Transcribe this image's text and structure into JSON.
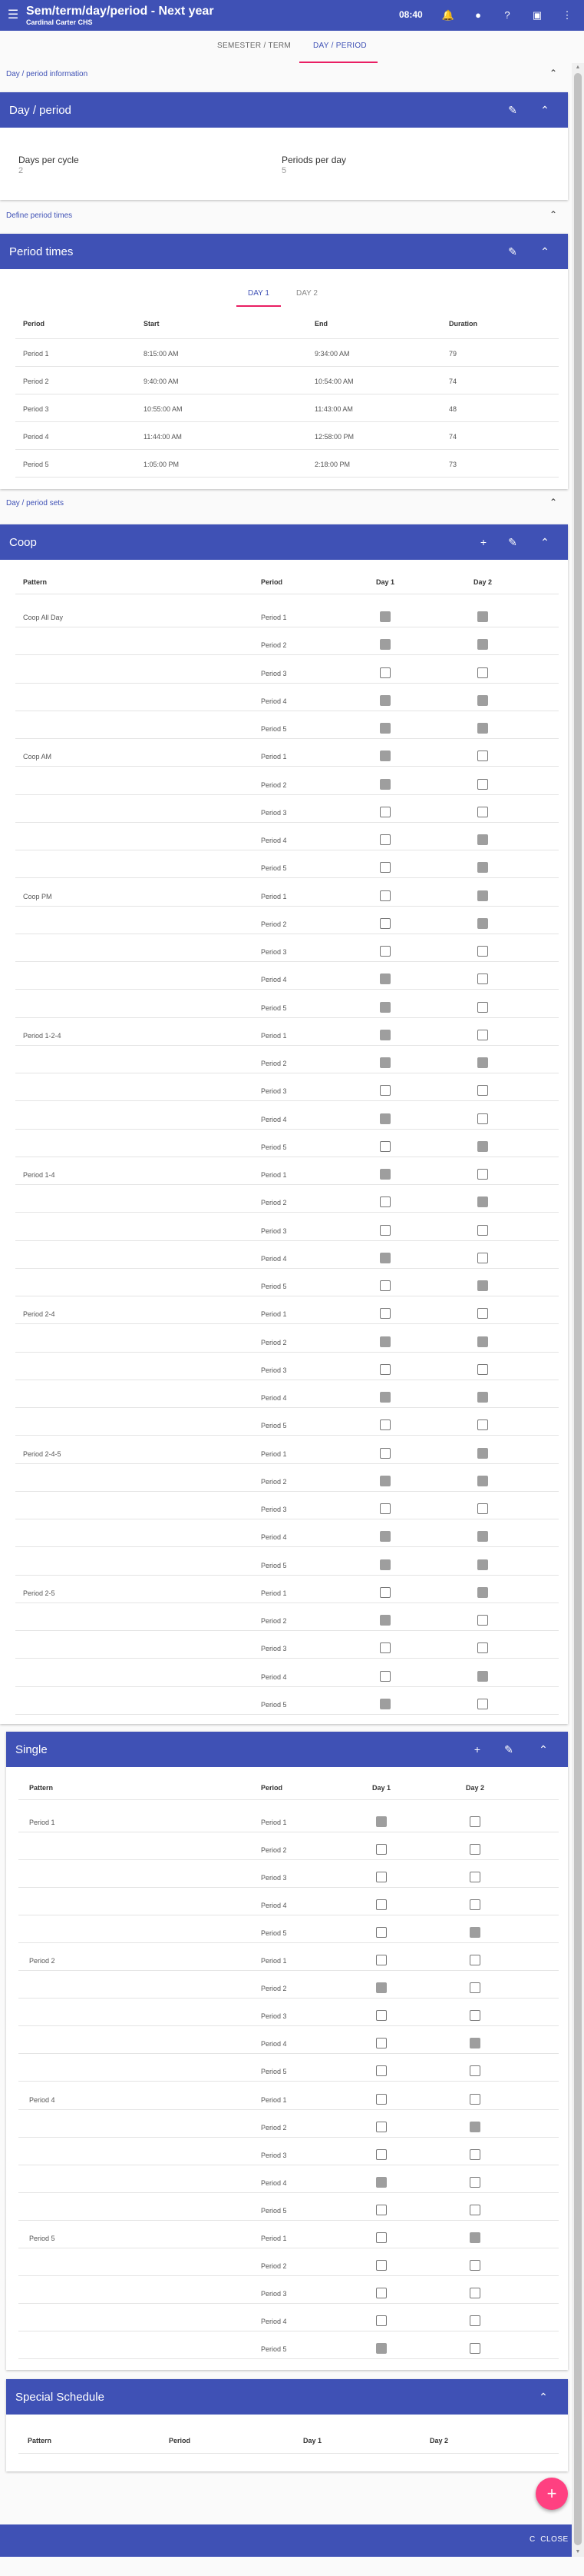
{
  "topbar": {
    "menu_icon": "menu-icon",
    "title": "Sem/term/day/period - Next year",
    "subtitle": "Cardinal Carter CHS",
    "time": "08:40",
    "icons": [
      "bell-icon",
      "person-icon",
      "help-icon",
      "screen-icon",
      "more-vert-icon"
    ]
  },
  "subnav": {
    "tabs": [
      "SEMESTER / TERM",
      "DAY / PERIOD"
    ],
    "active": 1
  },
  "day_period_information": {
    "section_title": "Day / period information",
    "card_title": "Day / period",
    "days_per_cycle_label": "Days per cycle",
    "days_per_cycle_value": "2",
    "periods_per_day_label": "Periods per day",
    "periods_per_day_value": "5"
  },
  "period_times": {
    "section_title": "Define period times",
    "card_title": "Period times",
    "tabs": [
      "DAY 1",
      "DAY 2"
    ],
    "active_tab": 0,
    "headers": [
      "Period",
      "Start",
      "End",
      "Duration"
    ],
    "rows": [
      [
        "Period 1",
        "8:15:00 AM",
        "9:34:00 AM",
        "79"
      ],
      [
        "Period 2",
        "9:40:00 AM",
        "10:54:00 AM",
        "74"
      ],
      [
        "Period 3",
        "10:55:00 AM",
        "11:43:00 AM",
        "48"
      ],
      [
        "Period 4",
        "11:44:00 AM",
        "12:58:00 PM",
        "74"
      ],
      [
        "Period 5",
        "1:05:00 PM",
        "2:18:00 PM",
        "73"
      ]
    ]
  },
  "period_sets": {
    "section_title": "Day / period sets",
    "headers": [
      "Pattern",
      "Period",
      "Day 1",
      "Day 2"
    ],
    "coop": {
      "title": "Coop",
      "patterns": [
        {
          "name": "Coop All Day",
          "periods": [
            "Period 1",
            "Period 2",
            "Period 3",
            "Period 4",
            "Period 5"
          ],
          "day1": [
            true,
            true,
            false,
            true,
            true
          ],
          "day2": [
            true,
            true,
            false,
            true,
            true
          ]
        },
        {
          "name": "Coop AM",
          "periods": [
            "Period 1",
            "Period 2",
            "Period 3",
            "Period 4",
            "Period 5"
          ],
          "day1": [
            true,
            true,
            false,
            false,
            false
          ],
          "day2": [
            false,
            false,
            false,
            true,
            true
          ]
        },
        {
          "name": "Coop PM",
          "periods": [
            "Period 1",
            "Period 2",
            "Period 3",
            "Period 4",
            "Period 5"
          ],
          "day1": [
            false,
            false,
            false,
            true,
            true
          ],
          "day2": [
            true,
            true,
            false,
            false,
            false
          ]
        },
        {
          "name": "Period 1-2-4",
          "periods": [
            "Period 1",
            "Period 2",
            "Period 3",
            "Period 4",
            "Period 5"
          ],
          "day1": [
            true,
            true,
            false,
            true,
            false
          ],
          "day2": [
            false,
            true,
            false,
            false,
            true
          ]
        },
        {
          "name": "Period 1-4",
          "periods": [
            "Period 1",
            "Period 2",
            "Period 3",
            "Period 4",
            "Period 5"
          ],
          "day1": [
            true,
            false,
            false,
            true,
            false
          ],
          "day2": [
            false,
            true,
            false,
            false,
            true
          ]
        },
        {
          "name": "Period 2-4",
          "periods": [
            "Period 1",
            "Period 2",
            "Period 3",
            "Period 4",
            "Period 5"
          ],
          "day1": [
            false,
            true,
            false,
            true,
            false
          ],
          "day2": [
            false,
            true,
            false,
            true,
            false
          ]
        },
        {
          "name": "Period 2-4-5",
          "periods": [
            "Period 1",
            "Period 2",
            "Period 3",
            "Period 4",
            "Period 5"
          ],
          "day1": [
            false,
            true,
            false,
            true,
            true
          ],
          "day2": [
            true,
            true,
            false,
            true,
            true
          ]
        },
        {
          "name": "Period 2-5",
          "periods": [
            "Period 1",
            "Period 2",
            "Period 3",
            "Period 4",
            "Period 5"
          ],
          "day1": [
            false,
            true,
            false,
            false,
            true
          ],
          "day2": [
            true,
            false,
            false,
            true,
            false
          ]
        }
      ]
    },
    "single": {
      "title": "Single",
      "patterns": [
        {
          "name": "Period 1",
          "periods": [
            "Period 1",
            "Period 2",
            "Period 3",
            "Period 4",
            "Period 5"
          ],
          "day1": [
            true,
            false,
            false,
            false,
            false
          ],
          "day2": [
            false,
            false,
            false,
            false,
            true
          ]
        },
        {
          "name": "Period 2",
          "periods": [
            "Period 1",
            "Period 2",
            "Period 3",
            "Period 4",
            "Period 5"
          ],
          "day1": [
            false,
            true,
            false,
            false,
            false
          ],
          "day2": [
            false,
            false,
            false,
            true,
            false
          ]
        },
        {
          "name": "Period 4",
          "periods": [
            "Period 1",
            "Period 2",
            "Period 3",
            "Period 4",
            "Period 5"
          ],
          "day1": [
            false,
            false,
            false,
            true,
            false
          ],
          "day2": [
            false,
            true,
            false,
            false,
            false
          ]
        },
        {
          "name": "Period 5",
          "periods": [
            "Period 1",
            "Period 2",
            "Period 3",
            "Period 4",
            "Period 5"
          ],
          "day1": [
            false,
            false,
            false,
            false,
            true
          ],
          "day2": [
            true,
            false,
            false,
            false,
            false
          ]
        }
      ]
    },
    "special": {
      "title": "Special Schedule"
    }
  },
  "footer": {
    "close_label": "CLOSE",
    "close_icon": "close-icon"
  },
  "fab_icon": "add-icon",
  "colors": {
    "primary": "#3f51b5",
    "accent": "#ff4081",
    "tab_ink": "#e91e63",
    "checked": "#9e9e9e"
  }
}
